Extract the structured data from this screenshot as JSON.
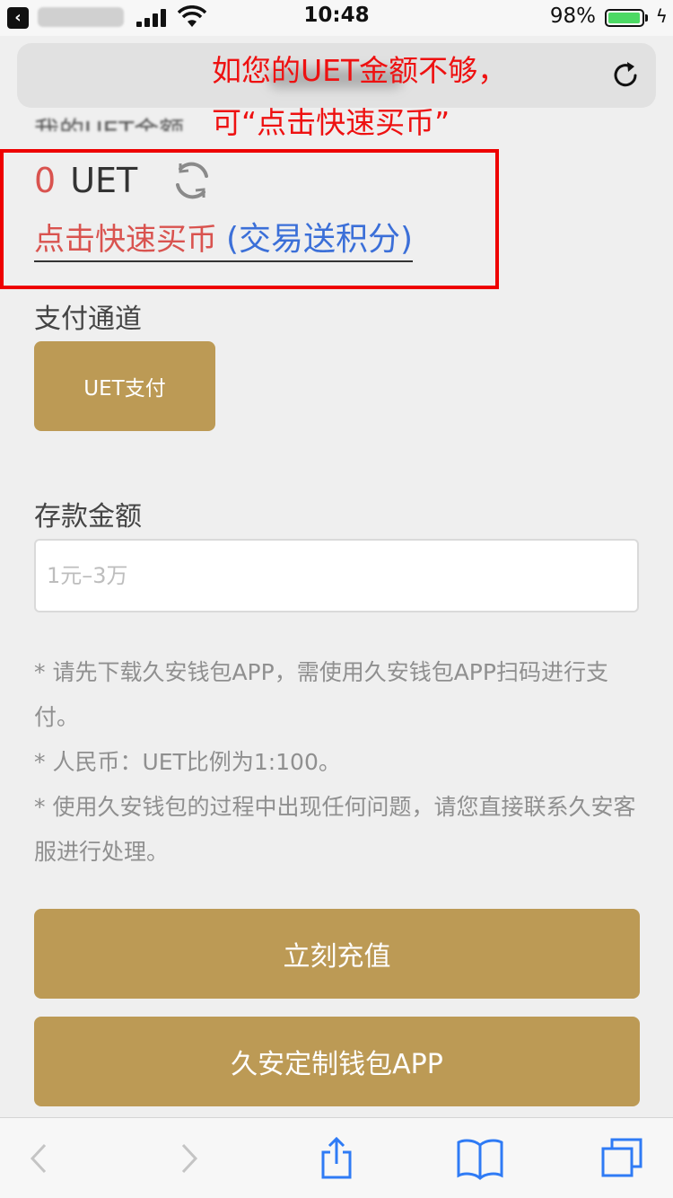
{
  "status_bar": {
    "time": "10:48",
    "battery_percent": "98%",
    "battery_level": 0.98,
    "icons": [
      "back-icon",
      "signal-icon",
      "wifi-icon",
      "battery-icon",
      "charging-icon"
    ]
  },
  "url_bar": {
    "reload_icon": "reload-icon"
  },
  "annotation": {
    "line1": "如您的UET金额不够，",
    "line2": "可“点击快速买币”",
    "color": "#ee1111"
  },
  "balance": {
    "value": "0",
    "unit": "UET",
    "refresh_icon": "refresh-icon"
  },
  "quick_buy": {
    "label": "点击快速买币",
    "bonus": "(交易送积分)"
  },
  "payment_channel": {
    "label": "支付通道",
    "option": "UET支付"
  },
  "deposit": {
    "label": "存款金额",
    "placeholder": "1元–3万",
    "value": ""
  },
  "notes": [
    "* 请先下载久安钱包APP，需使用久安钱包APP扫码进行支付。",
    "* 人民币：UET比例为1:100。",
    "* 使用久安钱包的过程中出现任何问题，请您直接联系久安客服进行处理。"
  ],
  "buttons": {
    "recharge": "立刻充值",
    "wallet_app": "久安定制钱包APP"
  },
  "colors": {
    "accent": "#bc9a55",
    "balance_red": "#d9534f",
    "link_blue": "#3b6fd8",
    "background": "#efefef"
  },
  "toolbar": {
    "icons": [
      "back-arrow-icon",
      "forward-arrow-icon",
      "share-icon",
      "bookmarks-icon",
      "tabs-icon"
    ]
  }
}
